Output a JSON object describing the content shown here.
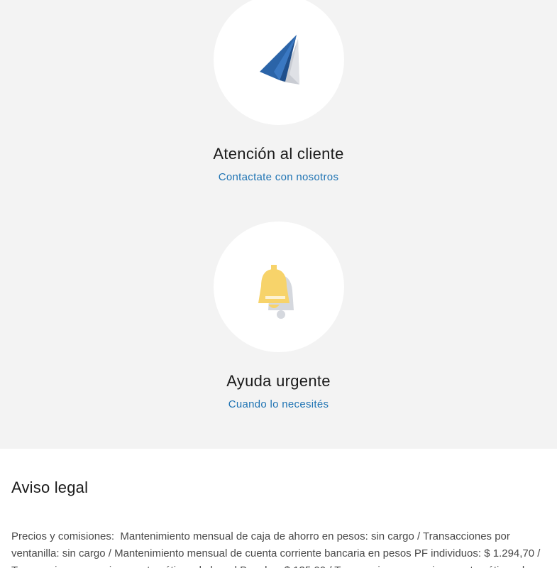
{
  "support_cards": [
    {
      "icon": "paper-plane-icon",
      "title": "Atención al cliente",
      "link": "Contactate con nosotros"
    },
    {
      "icon": "bell-icon",
      "title": "Ayuda urgente",
      "link": "Cuando lo necesités"
    }
  ],
  "legal": {
    "title": "Aviso legal",
    "label": "Precios y comisiones",
    "separator": ":",
    "text": "Mantenimiento mensual de caja de ahorro en pesos: sin cargo / Transacciones por ventanilla: sin cargo / Mantenimiento mensual de cuenta corriente bancaria en pesos PF individuos: $ 1.294,70 / Transacciones en cajeros automáticos de la red Banelco: $ 135,00 / Transacciones en cajeros automáticos de"
  },
  "colors": {
    "section_bg": "#f3f3f3",
    "link": "#1e73b3",
    "plane_blue": "#2b64a8",
    "bell_yellow": "#f7d36a"
  }
}
